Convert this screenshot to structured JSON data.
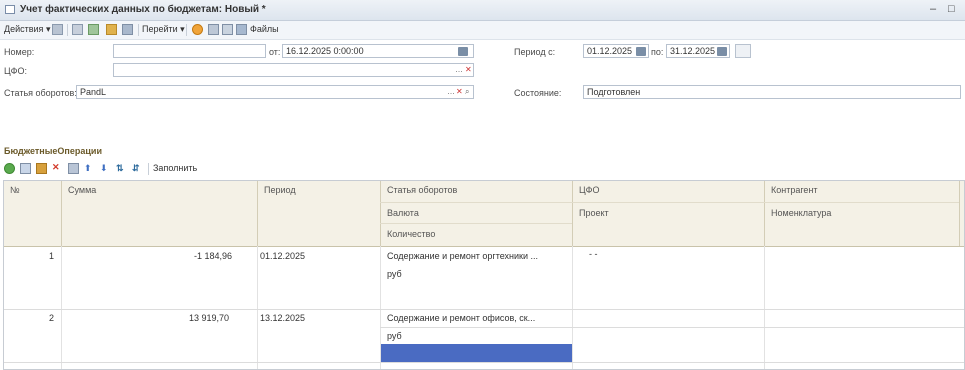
{
  "window": {
    "title": "Учет фактических данных по бюджетам: Новый *",
    "minimize": "–",
    "maximize": "□"
  },
  "toolbar": {
    "actions": "Действия",
    "goto": "Перейти",
    "files": "Файлы"
  },
  "form": {
    "number_label": "Номер:",
    "number_value": "",
    "from_label": "от:",
    "date_value": "16.12.2025 0:00:00",
    "period_label": "Период с:",
    "period_from": "01.12.2025",
    "period_to_label": "по:",
    "period_to": "31.12.2025",
    "cfo_label": "ЦФО:",
    "cfo_value": "",
    "article_label": "Статья оборотов:",
    "article_value": "PandL",
    "state_label": "Состояние:",
    "state_value": "Подготовлен"
  },
  "section": {
    "title": "БюджетныеОперации",
    "fill_label": "Заполнить"
  },
  "table": {
    "headers": {
      "num": "№",
      "sum": "Сумма",
      "period": "Период",
      "article": "Статья оборотов",
      "currency": "Валюта",
      "quantity": "Количество",
      "cfo": "ЦФО",
      "project": "Проект",
      "contractor": "Контрагент",
      "nomenclature": "Номенклатура"
    },
    "rows": [
      {
        "num": "1",
        "sum": "-1 184,96",
        "period": "01.12.2025",
        "article": "Содержание и ремонт оргтехники ...",
        "currency": "руб",
        "cfo": "-   -"
      },
      {
        "num": "2",
        "sum": "13 919,70",
        "period": "13.12.2025",
        "article": "Содержание и ремонт офисов, ск...",
        "currency": "руб",
        "cfo": ""
      }
    ]
  }
}
